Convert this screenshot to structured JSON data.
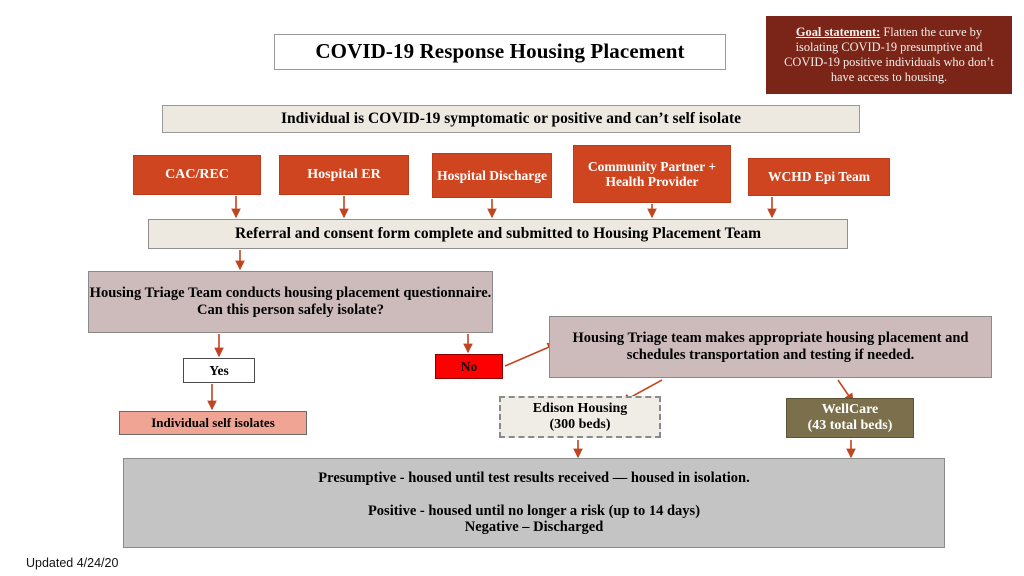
{
  "slide": {
    "title": "COVID-19 Response Housing Placement",
    "footer": "Updated 4/24/20"
  },
  "goal_statement": {
    "lead": "Goal statement:",
    "text": " Flatten the curve by isolating COVID-19 presumptive and COVID-19 positive individuals who don’t have access to housing.",
    "bg_color": "#7B2418",
    "text_color": "#F4EFE8"
  },
  "banner": {
    "individual": "Individual is COVID-19 symptomatic or positive and can’t self isolate",
    "referral": "Referral and consent form complete and submitted to Housing Placement Team",
    "bg_color": "#EDE9E1"
  },
  "sources": {
    "accent_color": "#CF4520",
    "items": [
      {
        "label": "CAC/REC"
      },
      {
        "label": "Hospital ER"
      },
      {
        "label": "Hospital Discharge"
      },
      {
        "label": "Community Partner + Health Provider"
      },
      {
        "label": "WCHD Epi Team"
      }
    ]
  },
  "triage": {
    "question_line1": "Housing Triage Team conducts housing placement questionnaire.",
    "question_line2": "Can this person safely isolate?",
    "placement": "Housing Triage team makes appropriate housing placement and schedules transportation and testing if needed.",
    "bg_color": "#CDBBBC"
  },
  "decision": {
    "yes_label": "Yes",
    "no_label": "No",
    "no_color": "#FF0000"
  },
  "outcomes": {
    "self_isolate": {
      "label": "Individual self isolates",
      "color": "#F0A494"
    },
    "edison": {
      "name": "Edison Housing",
      "capacity": "(300 beds)",
      "color": "#EFEDE6"
    },
    "wellcare": {
      "name": "WellCare",
      "capacity": "(43 total beds)",
      "color": "#7C6F4B"
    }
  },
  "summary": {
    "line1": "Presumptive - housed until test results received — housed in isolation.",
    "line2": "Positive - housed until no longer a risk (up to 14 days)",
    "line3": "Negative – Discharged",
    "bg_color": "#C4C4C4"
  },
  "connectors": {
    "arrow_color": "#C0451F"
  }
}
